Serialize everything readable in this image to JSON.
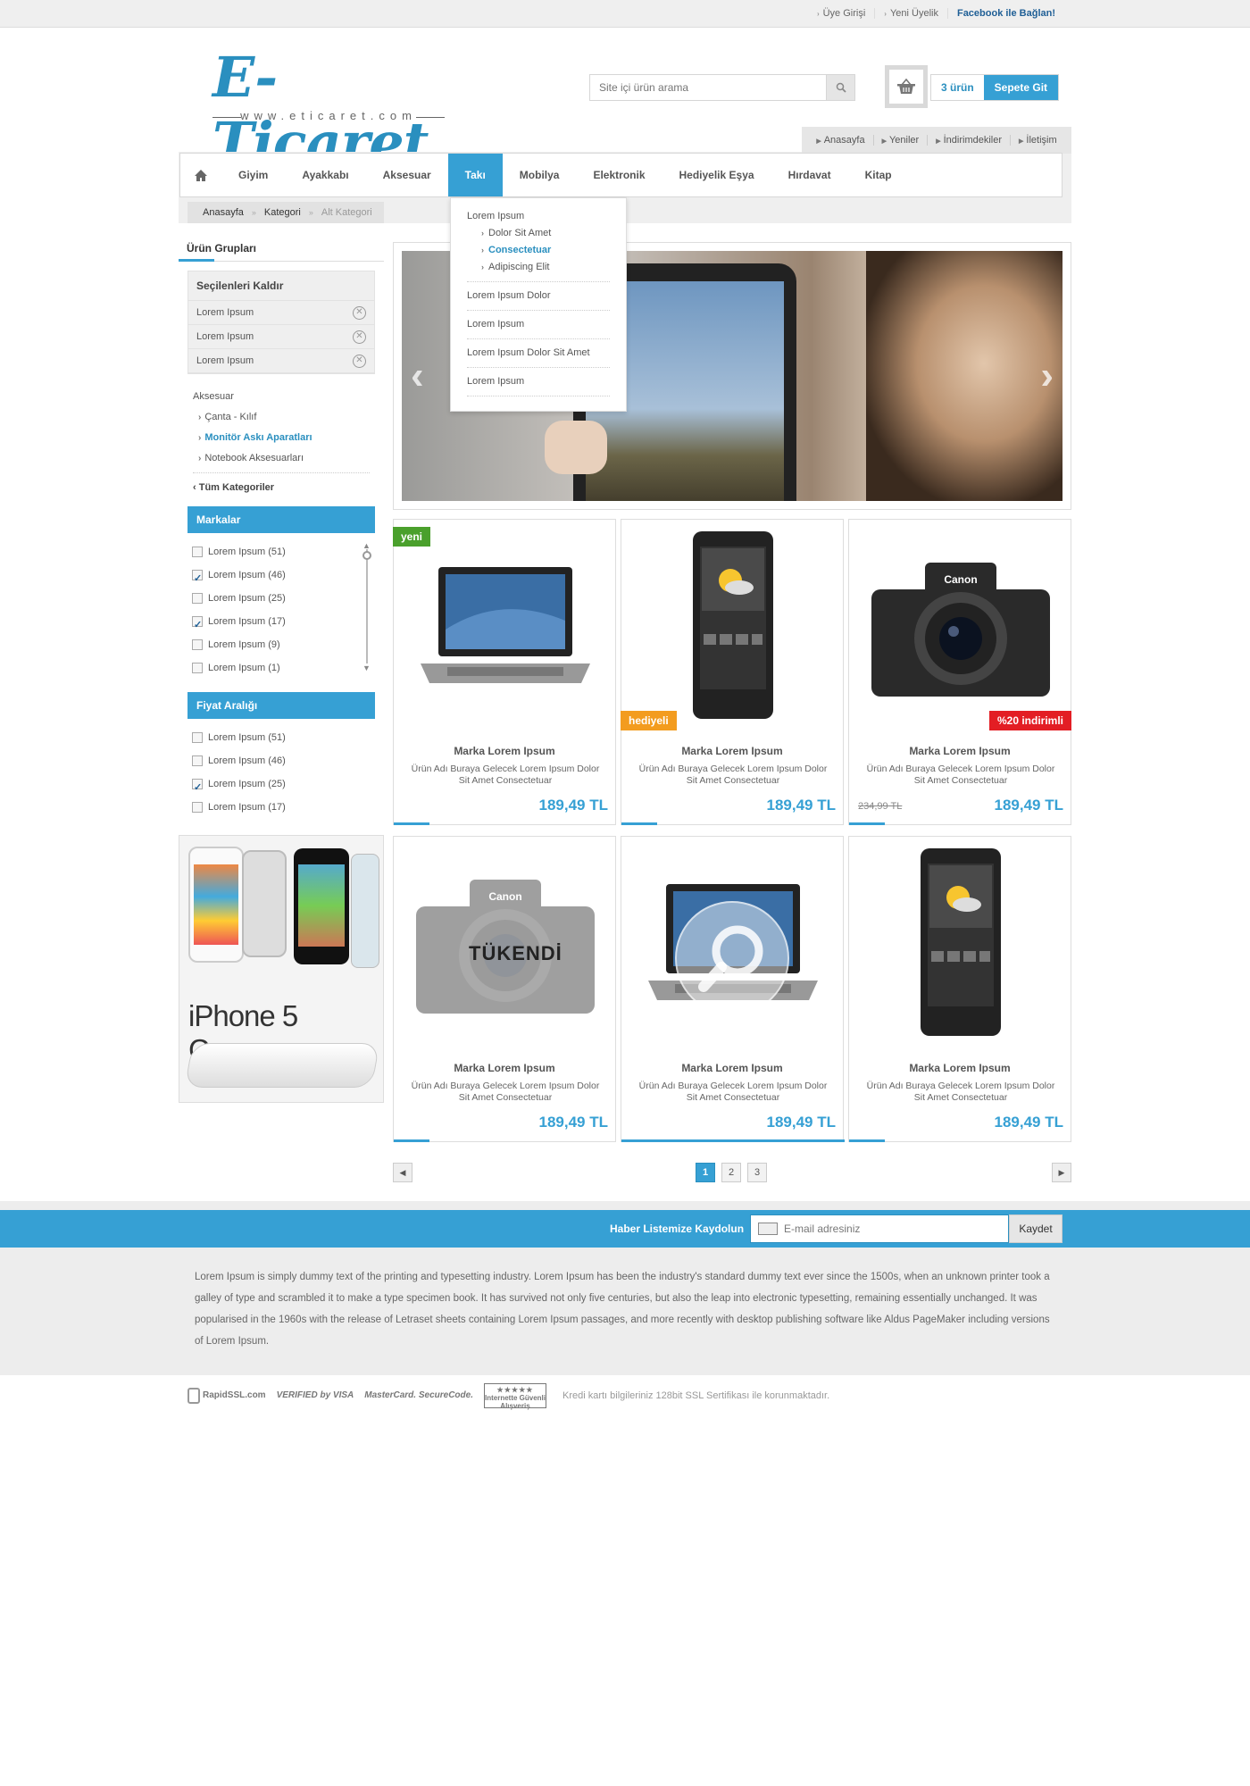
{
  "top_links": [
    "Üye Girişi",
    "Yeni Üyelik",
    "Facebook ile Bağlan!"
  ],
  "logo": {
    "name": "E-Ticaret",
    "url": "www.eticaret.com"
  },
  "search": {
    "placeholder": "Site içi ürün arama"
  },
  "cart": {
    "count": "3 ürün",
    "button": "Sepete Git"
  },
  "sub_nav": [
    "Anasayfa",
    "Yeniler",
    "İndirimdekiler",
    "İletişim"
  ],
  "main_nav": [
    "Giyim",
    "Ayakkabı",
    "Aksesuar",
    "Takı",
    "Mobilya",
    "Elektronik",
    "Hediyelik Eşya",
    "Hırdavat",
    "Kitap"
  ],
  "active_nav": "Takı",
  "breadcrumb": [
    "Anasayfa",
    "Kategori",
    "Alt Kategori"
  ],
  "dropdown": {
    "group1": "Lorem Ipsum",
    "subs": [
      "Dolor Sit Amet",
      "Consectetuar",
      "Adipiscing Elit"
    ],
    "items": [
      "Lorem Ipsum Dolor",
      "Lorem Ipsum",
      "Lorem Ipsum Dolor Sit Amet",
      "Lorem Ipsum"
    ]
  },
  "sidebar": {
    "title": "Ürün Grupları",
    "selected_header": "Seçilenleri Kaldır",
    "selected": [
      "Lorem Ipsum",
      "Lorem Ipsum",
      "Lorem Ipsum"
    ],
    "category": "Aksesuar",
    "subcats": [
      "Çanta - Kılıf",
      "Monitör Askı Aparatları",
      "Notebook Aksesuarları"
    ],
    "all_categories": "Tüm Kategoriler",
    "brands_title": "Markalar",
    "brands": [
      {
        "label": "Lorem Ipsum (51)",
        "checked": false
      },
      {
        "label": "Lorem Ipsum (46)",
        "checked": true
      },
      {
        "label": "Lorem Ipsum (25)",
        "checked": false
      },
      {
        "label": "Lorem Ipsum (17)",
        "checked": true
      },
      {
        "label": "Lorem Ipsum (9)",
        "checked": false
      },
      {
        "label": "Lorem Ipsum (1)",
        "checked": false
      }
    ],
    "price_title": "Fiyat Aralığı",
    "prices": [
      {
        "label": "Lorem Ipsum (51)",
        "checked": false
      },
      {
        "label": "Lorem Ipsum (46)",
        "checked": false
      },
      {
        "label": "Lorem Ipsum (25)",
        "checked": true
      },
      {
        "label": "Lorem Ipsum (17)",
        "checked": false
      }
    ],
    "banner_text": "iPhone 5 Cases"
  },
  "products": [
    {
      "brand": "Marka Lorem Ipsum",
      "desc": "Ürün Adı Buraya Gelecek Lorem Ipsum Dolor Sit Amet Consectetuar",
      "price": "189,49 TL",
      "tag": "yeni"
    },
    {
      "brand": "Marka Lorem Ipsum",
      "desc": "Ürün Adı Buraya Gelecek Lorem Ipsum Dolor Sit Amet Consectetuar",
      "price": "189,49 TL",
      "tag": "hediyeli"
    },
    {
      "brand": "Marka Lorem Ipsum",
      "desc": "Ürün Adı Buraya Gelecek Lorem Ipsum Dolor Sit Amet Consectetuar",
      "price": "189,49 TL",
      "old_price": "234,99 TL",
      "tag": "%20 indirimli"
    },
    {
      "brand": "Marka Lorem Ipsum",
      "desc": "Ürün Adı Buraya Gelecek Lorem Ipsum Dolor Sit Amet Consectetuar",
      "price": "189,49 TL",
      "overlay": "TÜKENDİ"
    },
    {
      "brand": "Marka Lorem Ipsum",
      "desc": "Ürün Adı Buraya Gelecek Lorem Ipsum Dolor Sit Amet Consectetuar",
      "price": "189,49 TL"
    },
    {
      "brand": "Marka Lorem Ipsum",
      "desc": "Ürün Adı Buraya Gelecek Lorem Ipsum Dolor Sit Amet Consectetuar",
      "price": "189,49 TL"
    }
  ],
  "pager": {
    "pages": [
      "1",
      "2",
      "3"
    ],
    "current": "1"
  },
  "newsletter": {
    "label": "Haber Listemize Kaydolun",
    "placeholder": "E-mail adresiniz",
    "button": "Kaydet"
  },
  "about": "Lorem Ipsum is simply dummy text of the printing and typesetting industry. Lorem Ipsum has been the industry's standard dummy text ever since the 1500s, when an unknown printer took a galley of type and scrambled it to make a type specimen book. It has survived not only five centuries, but also the leap into electronic typesetting, remaining essentially unchanged. It was popularised in the 1960s with the release of Letraset sheets containing Lorem Ipsum passages, and more recently with desktop publishing software like Aldus PageMaker including versions of Lorem Ipsum.",
  "security": {
    "badges": [
      "RapidSSL.com",
      "VERIFIED by VISA",
      "MasterCard. SecureCode.",
      "Internette Güvenli Alışveriş"
    ],
    "note": "Kredi kartı bilgileriniz 128bit SSL Sertifikası ile korunmaktadır."
  },
  "colors": {
    "accent": "#36a0d4",
    "new_tag": "#4aa02c",
    "gift_tag": "#f39c1f",
    "discount_tag": "#e31e24"
  }
}
